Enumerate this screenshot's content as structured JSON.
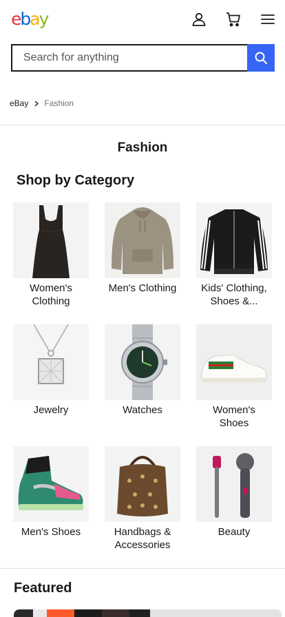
{
  "header": {
    "logo_letters": [
      "e",
      "b",
      "a",
      "y"
    ],
    "logo_colors": [
      "#e53238",
      "#0064d2",
      "#f5af02",
      "#86b817"
    ],
    "icons": [
      "account-icon",
      "cart-icon",
      "menu-icon"
    ]
  },
  "search": {
    "placeholder": "Search for anything",
    "button_icon": "search-icon",
    "accent": "#3665f3"
  },
  "breadcrumb": {
    "items": [
      "eBay",
      "Fashion"
    ]
  },
  "page": {
    "title": "Fashion"
  },
  "shop_by_category": {
    "heading": "Shop by Category",
    "categories": [
      {
        "label": "Women's Clothing",
        "image": "black-dress"
      },
      {
        "label": "Men's Clothing",
        "image": "tan-hoodie"
      },
      {
        "label": "Kids' Clothing, Shoes &...",
        "image": "track-jacket"
      },
      {
        "label": "Jewelry",
        "image": "diamond-pendant"
      },
      {
        "label": "Watches",
        "image": "wristwatch"
      },
      {
        "label": "Women's Shoes",
        "image": "white-sneaker"
      },
      {
        "label": "Men's Shoes",
        "image": "high-top-sneaker"
      },
      {
        "label": "Handbags & Accessories",
        "image": "monogram-bag"
      },
      {
        "label": "Beauty",
        "image": "hair-dryer"
      }
    ]
  },
  "featured": {
    "heading": "Featured"
  }
}
